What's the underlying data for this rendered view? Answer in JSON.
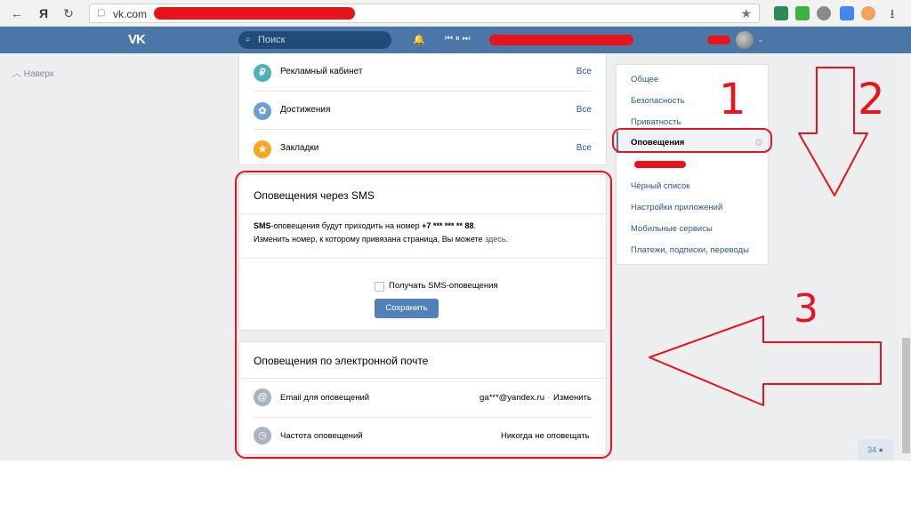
{
  "browser": {
    "back_glyph": "←",
    "yandex_glyph": "Я",
    "reload_glyph": "↻",
    "url": "vk.com",
    "star_glyph": "★",
    "download_glyph": "⭳"
  },
  "header": {
    "logo": "VK",
    "search_placeholder": "Поиск",
    "bell_glyph": "🔔",
    "player_glyph": "⏮ ⏸ ⏭",
    "chevron_glyph": "⌄",
    "accent_color": "#4a76a8"
  },
  "page": {
    "back_to_top": "Наверх"
  },
  "links_card": {
    "items": [
      {
        "icon": "ruble-icon",
        "icon_glyph": "₽",
        "icon_color": "#4bb3b8",
        "label": "Рекламный кабинет",
        "link": "Все"
      },
      {
        "icon": "award-icon",
        "icon_glyph": "✿",
        "icon_color": "#6a9ed6",
        "label": "Достижения",
        "link": "Все"
      },
      {
        "icon": "star-icon",
        "icon_glyph": "★",
        "icon_color": "#f5a623",
        "label": "Закладки",
        "link": "Все"
      }
    ]
  },
  "sms_section": {
    "title": "Оповещения через SMS",
    "line1_prefix_bold": "SMS",
    "line1_text": "-оповещения будут приходить на номер ",
    "line1_number": "+7 *** *** ** 88",
    "line1_end": ".",
    "line2_text": "Изменить номер, к которому привязана страница, Вы можете ",
    "line2_link": "здесь",
    "line2_end": ".",
    "checkbox_label": "Получать SMS-оповещения",
    "save_button": "Сохранить"
  },
  "email_section": {
    "title": "Оповещения по электронной почте",
    "email_icon_glyph": "@",
    "email_label": "Email для оповещений",
    "email_value": "ga***@yandex.ru",
    "email_separator": "·",
    "email_change": "Изменить",
    "freq_icon_glyph": "◷",
    "freq_label": "Частота оповещений",
    "freq_value": "Никогда не оповещать"
  },
  "right_menu": {
    "items": [
      {
        "label": "Общее",
        "active": false
      },
      {
        "label": "Безопасность",
        "active": false
      },
      {
        "label": "Приватность",
        "active": false
      },
      {
        "label": "Оповещения",
        "active": true
      },
      {
        "label": "Чёрный список",
        "active": false
      },
      {
        "label": "Настройки приложений",
        "active": false
      },
      {
        "label": "Мобильные сервисы",
        "active": false
      },
      {
        "label": "Платежи, подписки, переводы",
        "active": false
      }
    ],
    "gear_glyph": "⚙"
  },
  "annotations": {
    "n1": "1",
    "n2": "2",
    "n3": "3",
    "color": "#e8141c"
  },
  "online_counter": "34"
}
